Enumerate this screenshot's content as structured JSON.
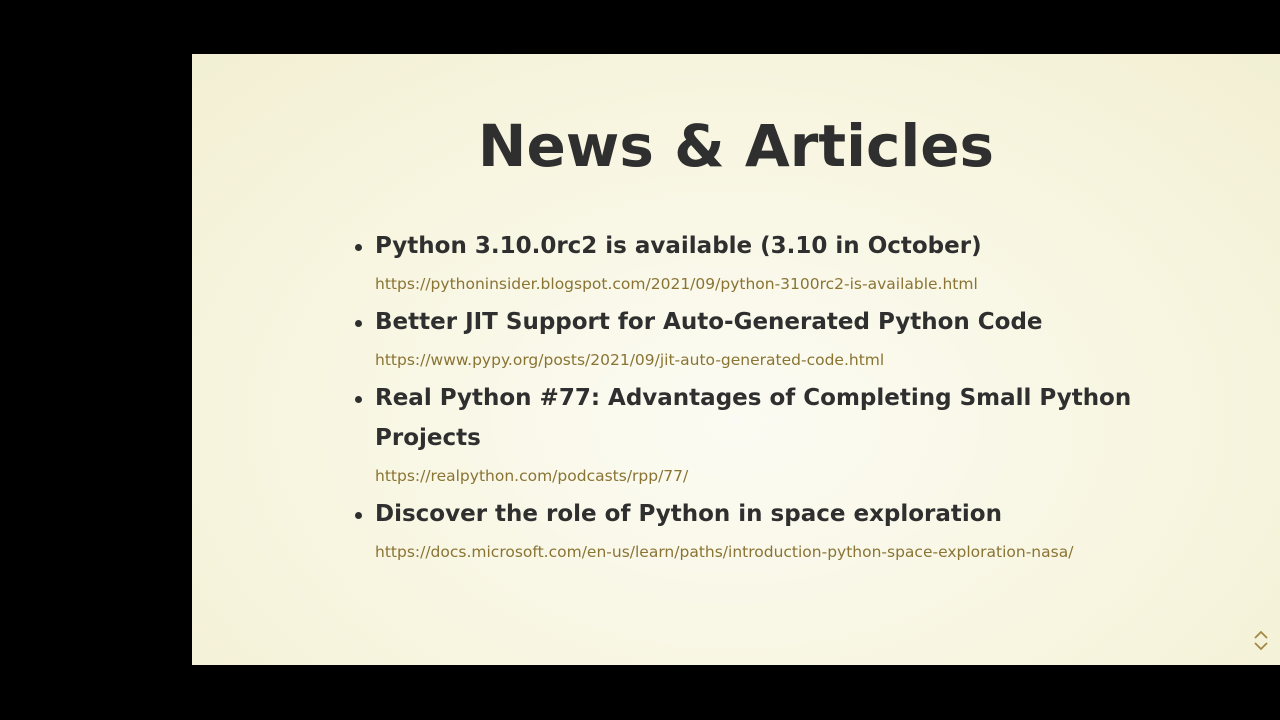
{
  "slide": {
    "title": "News & Articles",
    "articles": [
      {
        "title": "Python 3.10.0rc2 is available (3.10 in October)",
        "url": "https://pythoninsider.blogspot.com/2021/09/python-3100rc2-is-available.html"
      },
      {
        "title": "Better JIT Support for Auto-Generated Python Code",
        "url": "https://www.pypy.org/posts/2021/09/jit-auto-generated-code.html"
      },
      {
        "title": "Real Python #77: Advantages of Completing Small Python Projects",
        "url": "https://realpython.com/podcasts/rpp/77/"
      },
      {
        "title": "Discover the role of Python in space exploration",
        "url": "https://docs.microsoft.com/en-us/learn/paths/introduction-python-space-exploration-nasa/"
      }
    ]
  },
  "navigation": {
    "up_icon": "chevron-up-icon",
    "down_icon": "chevron-down-icon"
  },
  "colors": {
    "background": "#000000",
    "slide_background": "#f8f6e1",
    "text": "#2f2f2f",
    "link": "#8a7434"
  }
}
